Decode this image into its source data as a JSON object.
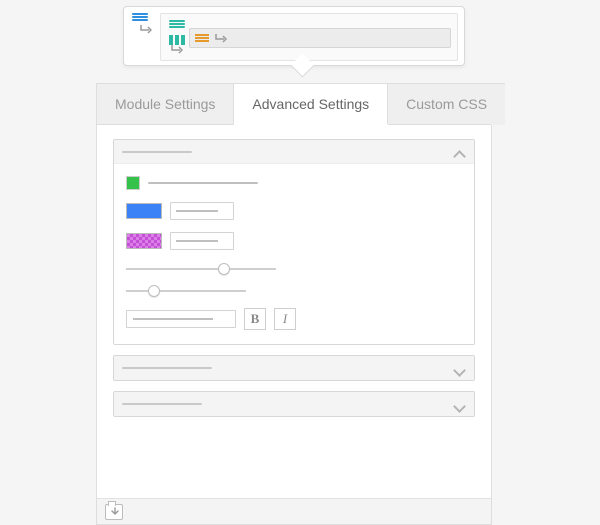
{
  "tabs": [
    "Module Settings",
    "Advanced Settings",
    "Custom CSS"
  ],
  "active_tab": 1,
  "top_preview": {
    "section_color": "#2f8fe0",
    "row_color": "#2db9a3",
    "module_color": "#e69a2b"
  },
  "sections": {
    "s0": {
      "expanded": true
    },
    "s1": {
      "expanded": false
    },
    "s2": {
      "expanded": false
    }
  },
  "design": {
    "swatch_green": "#35c24a",
    "color_blue": "#3b82f6",
    "color_magenta": "#c64fd8",
    "slider1": 0.67,
    "slider2": 0.2
  },
  "format_buttons": {
    "bold": "B",
    "italic": "I"
  },
  "icons": {
    "row_glyph": "row-icon",
    "folder_down": "save-icon"
  }
}
